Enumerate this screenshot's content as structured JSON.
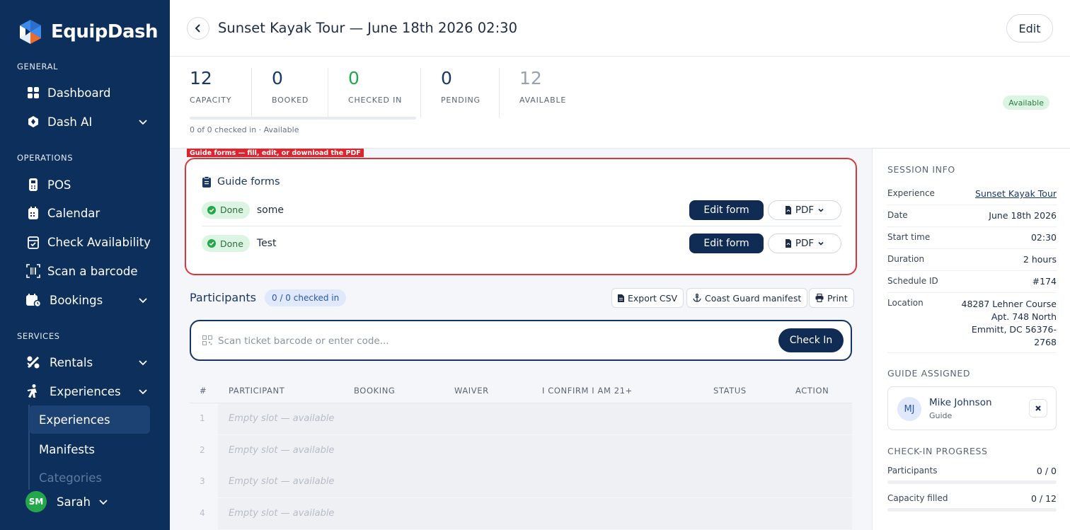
{
  "app": {
    "name": "EquipDash"
  },
  "sidebar": {
    "sections": {
      "general": "GENERAL",
      "operations": "OPERATIONS",
      "services": "SERVICES"
    },
    "items": [
      {
        "label": "Dashboard",
        "icon": "grid-icon"
      },
      {
        "label": "Dash AI",
        "icon": "ai-shield-icon"
      },
      {
        "label": "POS",
        "icon": "pos-terminal-icon"
      },
      {
        "label": "Calendar",
        "icon": "calendar-icon"
      },
      {
        "label": "Check Availability",
        "icon": "calendar-check-icon"
      },
      {
        "label": "Scan a barcode",
        "icon": "barcode-scan-icon"
      },
      {
        "label": "Bookings",
        "icon": "bookings-icon"
      },
      {
        "label": "Rentals",
        "icon": "rentals-icon"
      },
      {
        "label": "Experiences",
        "icon": "experiences-icon"
      }
    ],
    "sub_items": [
      {
        "label": "Experiences",
        "active": true
      },
      {
        "label": "Manifests",
        "active": false
      },
      {
        "label": "Categories",
        "active": false
      }
    ],
    "user": {
      "initials": "SM",
      "name": "Sarah"
    }
  },
  "header": {
    "title": "Sunset Kayak Tour — June 18th 2026 02:30",
    "edit_label": "Edit"
  },
  "stats": {
    "items": [
      {
        "value": "12",
        "label": "CAPACITY"
      },
      {
        "value": "0",
        "label": "BOOKED"
      },
      {
        "value": "0",
        "label": "CHECKED IN"
      },
      {
        "value": "0",
        "label": "PENDING"
      },
      {
        "value": "12",
        "label": "AVAILABLE"
      }
    ],
    "progress_fraction": 0,
    "progress_caption": "0 of 0 checked in · Available",
    "status": "Available"
  },
  "guide_forms": {
    "annotation": "Guide forms — fill, edit, or download the PDF",
    "title": "Guide forms",
    "rows": [
      {
        "status": "Done",
        "name": "some",
        "edit_label": "Edit form",
        "pdf_label": "PDF"
      },
      {
        "status": "Done",
        "name": "Test",
        "edit_label": "Edit form",
        "pdf_label": "PDF"
      }
    ]
  },
  "participants": {
    "title": "Participants",
    "checked_badge": "0 / 0 checked in",
    "export_label": "Export CSV",
    "manifest_label": "Coast Guard manifest",
    "print_label": "Print",
    "scan_placeholder": "Scan ticket barcode or enter code...",
    "checkin_label": "Check In",
    "columns": [
      "#",
      "PARTICIPANT",
      "BOOKING",
      "WAIVER",
      "I CONFIRM I AM 21+",
      "STATUS",
      "ACTION"
    ],
    "rows": [
      {
        "num": "1",
        "text": "Empty slot — available"
      },
      {
        "num": "2",
        "text": "Empty slot — available"
      },
      {
        "num": "3",
        "text": "Empty slot — available"
      },
      {
        "num": "4",
        "text": "Empty slot — available"
      }
    ]
  },
  "session_info": {
    "title": "SESSION INFO",
    "rows": [
      {
        "key": "Experience",
        "value": "Sunset Kayak Tour"
      },
      {
        "key": "Date",
        "value": "June 18th 2026"
      },
      {
        "key": "Start time",
        "value": "02:30"
      },
      {
        "key": "Duration",
        "value": "2 hours"
      },
      {
        "key": "Schedule ID",
        "value": "#174"
      },
      {
        "key": "Location",
        "value": "48287 Lehner Course Apt. 748 North Emmitt, DC 56376-2768"
      }
    ]
  },
  "guide_assigned": {
    "title": "GUIDE ASSIGNED",
    "initials": "MJ",
    "name": "Mike Johnson",
    "role": "Guide"
  },
  "checkin_progress": {
    "title": "CHECK-IN PROGRESS",
    "rows": [
      {
        "key": "Participants",
        "value": "0 / 0",
        "fraction": 0
      },
      {
        "key": "Capacity filled",
        "value": "0 / 12",
        "fraction": 0
      }
    ]
  },
  "colors": {
    "sidebar_bg": "#0c2f5c",
    "primary_button": "#102c54",
    "success_green": "#22a84a",
    "highlight_red": "#d9363e"
  }
}
